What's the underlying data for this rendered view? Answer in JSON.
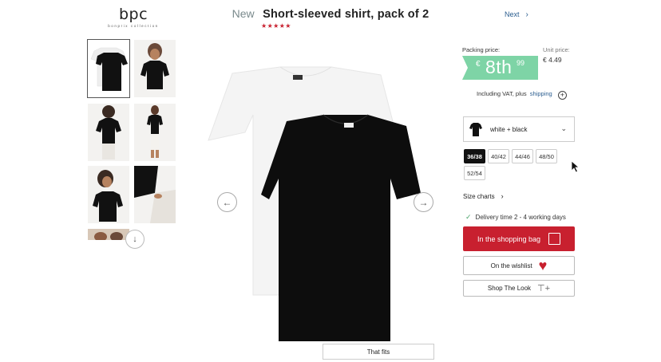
{
  "brand": {
    "name": "bpc",
    "tagline": "bonprix collection"
  },
  "product": {
    "badge": "New",
    "title": "Short-sleeved shirt, pack of 2",
    "stars": "★★★★★",
    "rating": 5
  },
  "nav": {
    "next_label": "Next",
    "next_icon": "chevron-right-icon"
  },
  "gallery": {
    "thumbnails": [
      {
        "label": "black tee flat",
        "selected": true
      },
      {
        "label": "model black tee",
        "selected": false
      },
      {
        "label": "model back view",
        "selected": false
      },
      {
        "label": "model full body",
        "selected": false
      },
      {
        "label": "model portrait",
        "selected": false
      },
      {
        "label": "detail close-up",
        "selected": false
      },
      {
        "label": "model partial",
        "selected": false
      }
    ],
    "scroll_icon": "arrow-down-icon",
    "prev_icon": "arrow-left-icon",
    "next_icon": "arrow-right-icon",
    "fit_label": "That fits"
  },
  "price": {
    "packing_label": "Packing price:",
    "currency": "€",
    "main": "8th",
    "cents": "99",
    "unit_label": "Unit price:",
    "unit_value": "€ 4.49",
    "vat_text": "Including VAT, plus",
    "shipping_link": "shipping",
    "badge_color": "#7ed4a6"
  },
  "variant": {
    "color_label": "white + black",
    "sizes": [
      {
        "label": "36/38",
        "active": true
      },
      {
        "label": "40/42",
        "active": false
      },
      {
        "label": "44/46",
        "active": false
      },
      {
        "label": "48/50",
        "active": false
      },
      {
        "label": "52/54",
        "active": false
      }
    ],
    "size_charts_label": "Size charts"
  },
  "delivery": {
    "text": "Delivery time 2 - 4 working days"
  },
  "actions": {
    "cart_label": "In the shopping bag",
    "wishlist_label": "On the wishlist",
    "look_label": "Shop The Look"
  },
  "colors": {
    "accent_red": "#c8202f",
    "price_green": "#7ed4a6",
    "link_blue": "#2a5d8f"
  }
}
